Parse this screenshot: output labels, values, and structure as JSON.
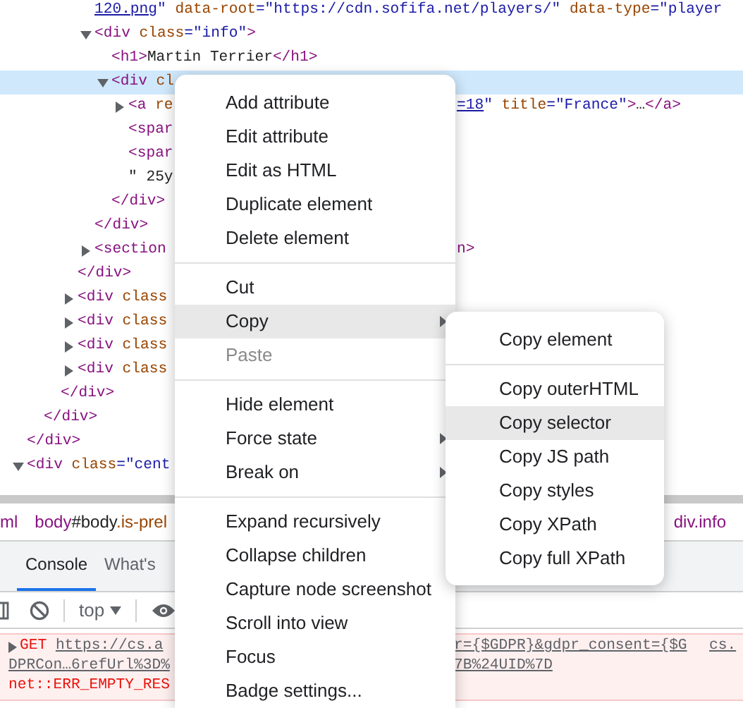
{
  "elements_tree": [
    {
      "children": [
        {
          "children": [
            {
              "children": [
                {
                  "children": [
                    {
                      "line": [
                        {
                          "kind": "link",
                          "text": "120.png"
                        },
                        {
                          "kind": "value",
                          "text": "\""
                        },
                        {
                          "kind": "attr",
                          "text": " data-root"
                        },
                        {
                          "kind": "value",
                          "text": "=\"https://cdn.sofifa.net/players/\""
                        },
                        {
                          "kind": "attr",
                          "text": " data-type"
                        },
                        {
                          "kind": "value",
                          "text": "=\"player"
                        }
                      ],
                      "selected": false
                    },
                    {
                      "line": [
                        {
                          "kind": "tag",
                          "text": "<div"
                        },
                        {
                          "kind": "attr",
                          "text": " class"
                        },
                        {
                          "kind": "value",
                          "text": "=\"info\""
                        },
                        {
                          "kind": "tag",
                          "text": ">"
                        }
                      ],
                      "expanded": true,
                      "selected": false,
                      "children": [
                        {
                          "line": [
                            {
                              "kind": "tag",
                              "text": "<h1>"
                            },
                            {
                              "kind": "text",
                              "text": "Martin Terrier"
                            },
                            {
                              "kind": "tag",
                              "text": "</h1>"
                            }
                          ],
                          "selected": false
                        },
                        {
                          "line": [
                            {
                              "kind": "tag",
                              "text": "<div"
                            },
                            {
                              "kind": "attr",
                              "text": " cl"
                            }
                          ],
                          "expanded": true,
                          "selected": true,
                          "children": [
                            {
                              "line": [
                                {
                                  "kind": "tag",
                                  "text": "<a"
                                },
                                {
                                  "kind": "attr",
                                  "text": " re"
                                }
                              ],
                              "tail": [
                                {
                                  "kind": "link",
                                  "text": "=18"
                                },
                                {
                                  "kind": "value",
                                  "text": "\""
                                },
                                {
                                  "kind": "attr",
                                  "text": " title"
                                },
                                {
                                  "kind": "value",
                                  "text": "=\"France\""
                                },
                                {
                                  "kind": "tag",
                                  "text": ">"
                                },
                                {
                                  "kind": "text",
                                  "text": "…"
                                },
                                {
                                  "kind": "tag",
                                  "text": "</a>"
                                }
                              ],
                              "expanded": false,
                              "selected": false
                            },
                            {
                              "line": [
                                {
                                  "kind": "tag",
                                  "text": "<spar"
                                }
                              ],
                              "selected": false
                            },
                            {
                              "line": [
                                {
                                  "kind": "tag",
                                  "text": "<spar"
                                }
                              ],
                              "selected": false
                            },
                            {
                              "line": [
                                {
                                  "kind": "text",
                                  "text": "\" 25y"
                                }
                              ],
                              "selected": false
                            }
                          ],
                          "close": [
                            {
                              "kind": "tag",
                              "text": "</div>"
                            }
                          ]
                        }
                      ],
                      "close": [
                        {
                          "kind": "tag",
                          "text": "</div>"
                        }
                      ]
                    },
                    {
                      "line": [
                        {
                          "kind": "tag",
                          "text": "<section"
                        }
                      ],
                      "tail": [
                        {
                          "kind": "tag",
                          "text": "n>"
                        }
                      ],
                      "expanded": false,
                      "selected": false
                    }
                  ],
                  "close": [
                    {
                      "kind": "tag",
                      "text": "</div>"
                    }
                  ]
                },
                {
                  "line": [
                    {
                      "kind": "tag",
                      "text": "<div"
                    },
                    {
                      "kind": "attr",
                      "text": " class"
                    }
                  ],
                  "expanded": false,
                  "selected": false
                },
                {
                  "line": [
                    {
                      "kind": "tag",
                      "text": "<div"
                    },
                    {
                      "kind": "attr",
                      "text": " class"
                    }
                  ],
                  "expanded": false,
                  "selected": false
                },
                {
                  "line": [
                    {
                      "kind": "tag",
                      "text": "<div"
                    },
                    {
                      "kind": "attr",
                      "text": " class"
                    }
                  ],
                  "expanded": false,
                  "selected": false
                },
                {
                  "line": [
                    {
                      "kind": "tag",
                      "text": "<div"
                    },
                    {
                      "kind": "attr",
                      "text": " class"
                    }
                  ],
                  "expanded": false,
                  "selected": false
                }
              ],
              "close": [
                {
                  "kind": "tag",
                  "text": "</div>"
                }
              ]
            }
          ],
          "close": [
            {
              "kind": "tag",
              "text": "</div>"
            }
          ]
        }
      ],
      "close": [
        {
          "kind": "tag",
          "text": "</div>"
        }
      ]
    },
    {
      "line": [
        {
          "kind": "tag",
          "text": "<div"
        },
        {
          "kind": "attr",
          "text": " class"
        },
        {
          "kind": "value",
          "text": "=\"cent"
        }
      ],
      "expanded": true,
      "selected": false
    }
  ],
  "breadcrumbs": [
    {
      "parts": [
        {
          "kind": "tag",
          "text": "ml"
        }
      ]
    },
    {
      "parts": [
        {
          "kind": "tag",
          "text": "body"
        },
        {
          "kind": "id",
          "text": "#body"
        },
        {
          "kind": "class",
          "text": ".is-prel"
        }
      ]
    },
    {
      "parts": [
        {
          "kind": "tag",
          "text": "div.info"
        }
      ]
    }
  ],
  "drawer_tabs": [
    {
      "label": "Console",
      "selected": true
    },
    {
      "label": "What's",
      "selected": false
    }
  ],
  "console_toolbar": {
    "context": "top"
  },
  "console_messages": [
    {
      "rows": [
        {
          "parts": [
            {
              "kind": "method",
              "text": "GET"
            },
            {
              "kind": "url",
              "text": "https://cs.a"
            }
          ],
          "tail": [
            {
              "kind": "url",
              "text": "r={$GDPR}&gdpr_consent={$G"
            }
          ],
          "source": "cs."
        },
        {
          "parts": [
            {
              "kind": "url",
              "text": "DPRCon…6refUrl%3D%"
            }
          ],
          "tail": [
            {
              "kind": "url",
              "text": "7B%24UID%7D"
            }
          ]
        },
        {
          "parts": [
            {
              "kind": "error",
              "text": "net::ERR_EMPTY_RES"
            }
          ]
        }
      ]
    }
  ],
  "context_menu": {
    "items": [
      {
        "kind": "item",
        "label": "Add attribute",
        "selected": false,
        "disabled": false,
        "submenu": false
      },
      {
        "kind": "item",
        "label": "Edit attribute",
        "selected": false,
        "disabled": false,
        "submenu": false
      },
      {
        "kind": "item",
        "label": "Edit as HTML",
        "selected": false,
        "disabled": false,
        "submenu": false
      },
      {
        "kind": "item",
        "label": "Duplicate element",
        "selected": false,
        "disabled": false,
        "submenu": false
      },
      {
        "kind": "item",
        "label": "Delete element",
        "selected": false,
        "disabled": false,
        "submenu": false
      },
      {
        "kind": "separator"
      },
      {
        "kind": "item",
        "label": "Cut",
        "selected": false,
        "disabled": false,
        "submenu": false
      },
      {
        "kind": "item",
        "label": "Copy",
        "selected": true,
        "disabled": false,
        "submenu": true
      },
      {
        "kind": "item",
        "label": "Paste",
        "selected": false,
        "disabled": true,
        "submenu": false
      },
      {
        "kind": "separator"
      },
      {
        "kind": "item",
        "label": "Hide element",
        "selected": false,
        "disabled": false,
        "submenu": false
      },
      {
        "kind": "item",
        "label": "Force state",
        "selected": false,
        "disabled": false,
        "submenu": true
      },
      {
        "kind": "item",
        "label": "Break on",
        "selected": false,
        "disabled": false,
        "submenu": true
      },
      {
        "kind": "separator"
      },
      {
        "kind": "item",
        "label": "Expand recursively",
        "selected": false,
        "disabled": false,
        "submenu": false
      },
      {
        "kind": "item",
        "label": "Collapse children",
        "selected": false,
        "disabled": false,
        "submenu": false
      },
      {
        "kind": "item",
        "label": "Capture node screenshot",
        "selected": false,
        "disabled": false,
        "submenu": false
      },
      {
        "kind": "item",
        "label": "Scroll into view",
        "selected": false,
        "disabled": false,
        "submenu": false
      },
      {
        "kind": "item",
        "label": "Focus",
        "selected": false,
        "disabled": false,
        "submenu": false
      },
      {
        "kind": "item",
        "label": "Badge settings...",
        "selected": false,
        "disabled": false,
        "submenu": false
      }
    ]
  },
  "copy_submenu": {
    "items": [
      {
        "kind": "item",
        "label": "Copy element",
        "selected": false
      },
      {
        "kind": "separator"
      },
      {
        "kind": "item",
        "label": "Copy outerHTML",
        "selected": false
      },
      {
        "kind": "item",
        "label": "Copy selector",
        "selected": true
      },
      {
        "kind": "item",
        "label": "Copy JS path",
        "selected": false
      },
      {
        "kind": "item",
        "label": "Copy styles",
        "selected": false
      },
      {
        "kind": "item",
        "label": "Copy XPath",
        "selected": false
      },
      {
        "kind": "item",
        "label": "Copy full XPath",
        "selected": false
      }
    ]
  }
}
